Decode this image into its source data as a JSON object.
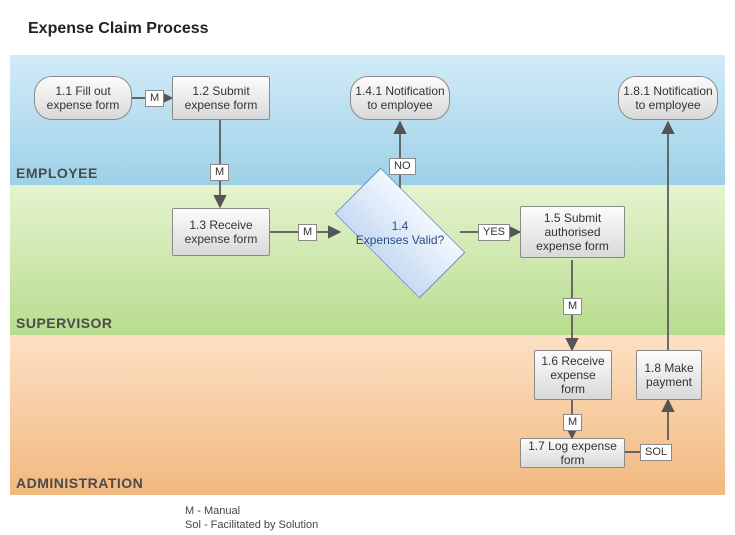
{
  "title": "Expense Claim Process",
  "lanes": {
    "employee": "EMPLOYEE",
    "supervisor": "SUPERVISOR",
    "administration": "ADMINISTRATION"
  },
  "nodes": {
    "n11": "1.1 Fill out expense form",
    "n12": "1.2 Submit expense form",
    "n13": "1.3 Receive expense form",
    "n14_num": "1.4",
    "n14_q": "Expenses  Valid?",
    "n141": "1.4.1 Notification to employee",
    "n15": "1.5 Submit authorised expense form",
    "n16": "1.6 Receive expense form",
    "n17": "1.7 Log expense form",
    "n18": "1.8 Make payment",
    "n181": "1.8.1 Notification to employee"
  },
  "edgeLabels": {
    "m": "M",
    "no": "NO",
    "yes": "YES",
    "sol": "SOL"
  },
  "legend": {
    "l1": "M - Manual",
    "l2": "Sol - Facilitated by Solution"
  }
}
